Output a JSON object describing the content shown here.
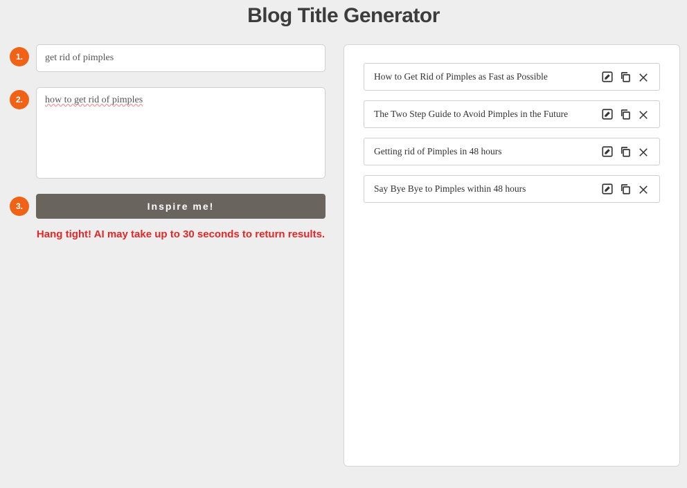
{
  "title": "Blog Title Generator",
  "steps": {
    "one": {
      "num": "1.",
      "value": "get rid of pimples"
    },
    "two": {
      "num": "2.",
      "value": "how to get rid of pimples"
    },
    "three": {
      "num": "3.",
      "button": "Inspire me!"
    }
  },
  "wait_message": "Hang tight! AI may take up to 30 seconds to return results.",
  "results": [
    "How to Get Rid of Pimples as Fast as Possible",
    "The Two Step Guide to Avoid Pimples in the Future",
    "Getting rid of Pimples in 48 hours",
    "Say Bye Bye to Pimples within 48 hours"
  ]
}
